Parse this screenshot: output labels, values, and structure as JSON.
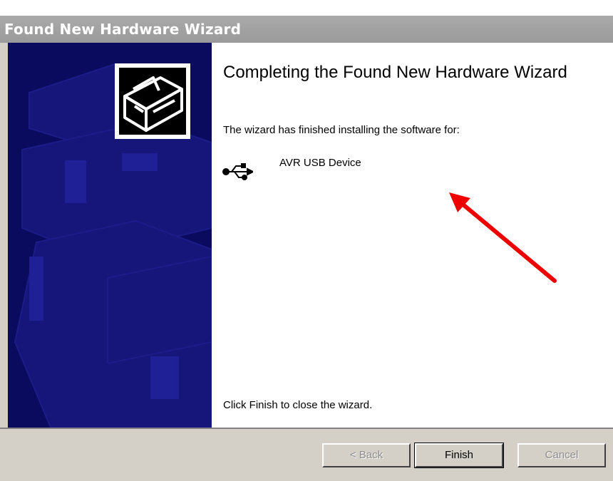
{
  "window": {
    "title": "Found New Hardware Wizard"
  },
  "content": {
    "heading": "Completing the Found New Hardware Wizard",
    "intro": "The wizard has finished installing the software for:",
    "device": {
      "icon": "usb-icon",
      "name": "AVR USB Device"
    },
    "closing": "Click Finish to close the wizard."
  },
  "buttons": {
    "back_label": "< Back",
    "finish_label": "Finish",
    "cancel_label": "Cancel"
  },
  "colors": {
    "side_panel": "#0a0a5e",
    "title_bar": "#a0a0a0",
    "button_face": "#d4d0c8",
    "annotation_arrow": "#ee0000"
  }
}
